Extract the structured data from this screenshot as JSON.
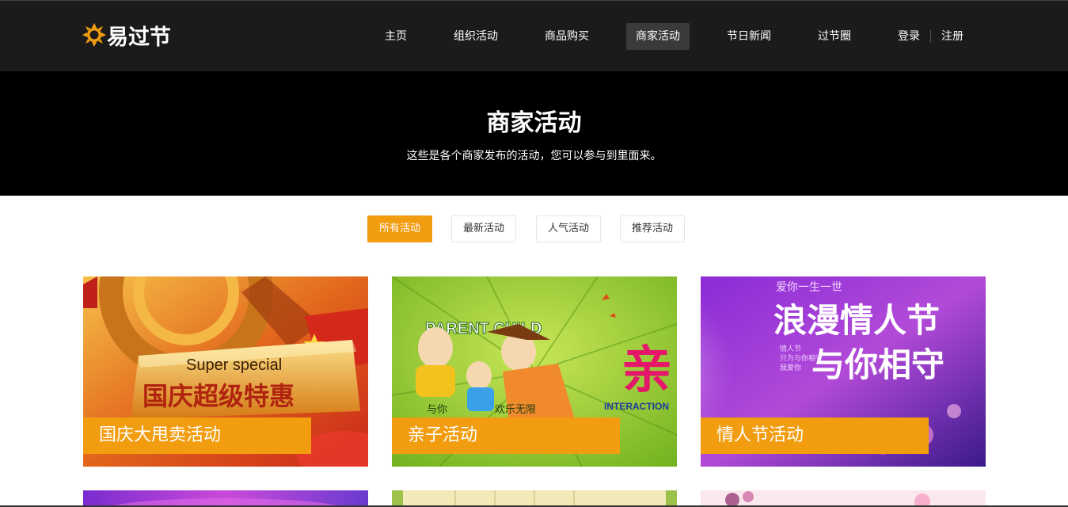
{
  "brand": {
    "name": "易过节"
  },
  "nav": {
    "items": [
      {
        "label": "主页"
      },
      {
        "label": "组织活动"
      },
      {
        "label": "商品购买"
      },
      {
        "label": "商家活动"
      },
      {
        "label": "节日新闻"
      },
      {
        "label": "过节圈"
      }
    ],
    "login": "登录",
    "register": "注册"
  },
  "banner": {
    "title": "商家活动",
    "subtitle": "这些是各个商家发布的活动，您可以参与到里面来。"
  },
  "filters": [
    {
      "label": "所有活动"
    },
    {
      "label": "最新活动"
    },
    {
      "label": "人气活动"
    },
    {
      "label": "推荐活动"
    }
  ],
  "cards": [
    {
      "label": "国庆大甩卖活动",
      "art_text_en": "Super special",
      "art_text_cn": "国庆超级特惠"
    },
    {
      "label": "亲子活动",
      "art_text_en": "PARENT CHILD",
      "art_text_cn": "欢乐无限",
      "art_text_side": "亲",
      "art_text_sub": "INTERACTION",
      "art_text_small": "与你"
    },
    {
      "label": "情人节活动",
      "art_text_top": "爱你一生一世",
      "art_text_main1": "浪漫情人节",
      "art_text_main2": "与你相守",
      "art_text_small1": "情人节",
      "art_text_small2": "只为与你相守",
      "art_text_small3": "我爱你"
    }
  ],
  "colors": {
    "accent": "#f29c10",
    "header_bg": "#1b1b1b",
    "banner_bg": "#000000"
  }
}
